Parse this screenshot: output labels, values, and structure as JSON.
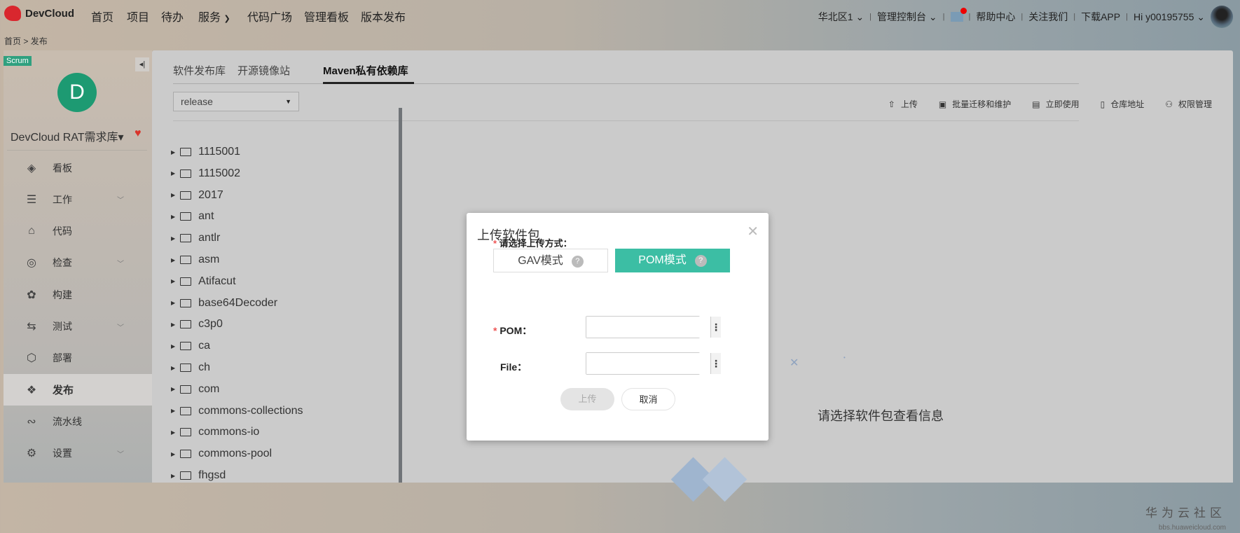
{
  "brand": "DevCloud",
  "nav": [
    "首页",
    "项目",
    "待办",
    "服务",
    "代码广场",
    "管理看板",
    "版本发布"
  ],
  "right_nav": {
    "region": "华北区1",
    "console": "管理控制台",
    "help": "帮助中心",
    "follow": "关注我们",
    "download": "下载APP",
    "user": "Hi y00195755"
  },
  "breadcrumb": {
    "home": "首页",
    "sep": ">",
    "current": "发布"
  },
  "sidebar": {
    "badge": "Scrum",
    "avatar_letter": "D",
    "project": "DevCloud RAT需求库▾",
    "items": [
      {
        "label": "看板",
        "icon": "layers-icon",
        "chev": false
      },
      {
        "label": "工作",
        "icon": "list-icon",
        "chev": true
      },
      {
        "label": "代码",
        "icon": "code-icon",
        "chev": false
      },
      {
        "label": "检查",
        "icon": "target-icon",
        "chev": true
      },
      {
        "label": "构建",
        "icon": "gear-build-icon",
        "chev": false
      },
      {
        "label": "测试",
        "icon": "test-icon",
        "chev": true
      },
      {
        "label": "部署",
        "icon": "cube-icon",
        "chev": false
      },
      {
        "label": "发布",
        "icon": "release-icon",
        "chev": false,
        "active": true
      },
      {
        "label": "流水线",
        "icon": "pipeline-icon",
        "chev": false
      },
      {
        "label": "设置",
        "icon": "settings-icon",
        "chev": true
      }
    ]
  },
  "tabs": [
    "软件发布库",
    "开源镜像站",
    "Maven私有依赖库"
  ],
  "repo_select": "release",
  "toolbar": [
    {
      "label": "上传",
      "icon": "upload-icon",
      "glyph": "⇧"
    },
    {
      "label": "批量迁移和维护",
      "icon": "briefcase-icon",
      "glyph": "▣"
    },
    {
      "label": "立即使用",
      "icon": "book-icon",
      "glyph": "▤"
    },
    {
      "label": "仓库地址",
      "icon": "file-icon",
      "glyph": "▯"
    },
    {
      "label": "权限管理",
      "icon": "user-key-icon",
      "glyph": "⚇"
    }
  ],
  "tree": [
    "1115001",
    "1115002",
    "2017",
    "ant",
    "antlr",
    "asm",
    "Atifacut",
    "base64Decoder",
    "c3p0",
    "ca",
    "ch",
    "com",
    "commons-collections",
    "commons-io",
    "commons-pool",
    "fhgsd"
  ],
  "empty_text": "请选择软件包查看信息",
  "watermark": {
    "cn": "华为云社区",
    "url": "bbs.huaweicloud.com"
  },
  "dialog": {
    "title": "上传软件包",
    "mode_label": "请选择上传方式：",
    "modes": [
      "GAV模式",
      "POM模式"
    ],
    "selected_mode": "POM模式",
    "pom_label": "POM：",
    "file_label": "File：",
    "pom_value": "",
    "file_value": "",
    "upload": "上传",
    "cancel": "取消"
  },
  "colors": {
    "accent": "#3cbea4",
    "avatar": "#1d9a72"
  }
}
